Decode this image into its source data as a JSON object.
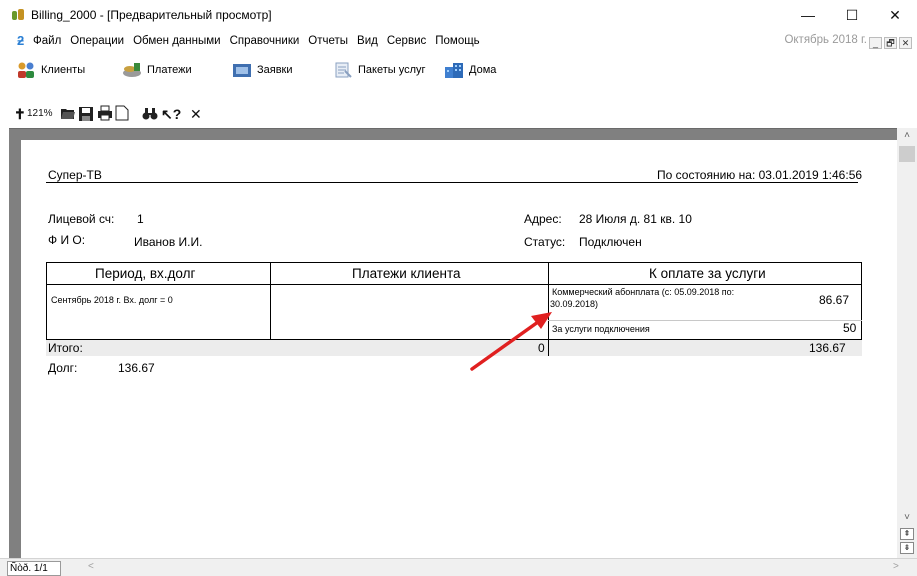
{
  "window": {
    "title": "Billing_2000 - [Предварительный просмотр]",
    "minimize": "—",
    "maximize": "☐",
    "close": "✕"
  },
  "menu": {
    "items": [
      "Файл",
      "Операции",
      "Обмен данными",
      "Справочники",
      "Отчеты",
      "Вид",
      "Сервис",
      "Помощь"
    ],
    "period": "Октябрь 2018 г.",
    "mdi_min": "_",
    "mdi_restore": "🗗",
    "mdi_close": "✕"
  },
  "toolbar": {
    "clients": "Клиенты",
    "payments": "Платежи",
    "requests": "Заявки",
    "packages": "Пакеты услуг",
    "houses": "Дома"
  },
  "preview_toolbar": {
    "zoom": "121%"
  },
  "report": {
    "company": "Супер-ТВ",
    "as_of": "По состоянию на: 03.01.2019 1:46:56",
    "account_label": "Лицевой сч:",
    "account_value": "1",
    "fio_label": "Ф И О:",
    "fio_value": "Иванов И.И.",
    "address_label": "Адрес:",
    "address_value": "28 Июля  д. 81 кв. 10",
    "status_label": "Статус:",
    "status_value": "Подключен",
    "col1": "Период,  вх.долг",
    "col2": "Платежи клиента",
    "col3": "К оплате за услуги",
    "period_row": "Сентябрь 2018 г.  Вх. долг = 0",
    "service1_line1": "Коммерческий абонплата (с: 05.09.2018 по:",
    "service1_line2": "30.09.2018)",
    "service1_amount": "86.67",
    "service2": "За услуги подключения",
    "service2_amount": "50",
    "total_label": "Итого:",
    "total_payments": "0",
    "total_due": "136.67",
    "debt_label": "Долг:",
    "debt_value": "136.67"
  },
  "statusbar": {
    "page": "Ñòð. 1/1",
    "scroll_left": "<",
    "scroll_right": ">"
  },
  "colors": {
    "preview_bg": "#808080",
    "arrow": "#e02020",
    "menu_logo": "#2a7fd4"
  }
}
